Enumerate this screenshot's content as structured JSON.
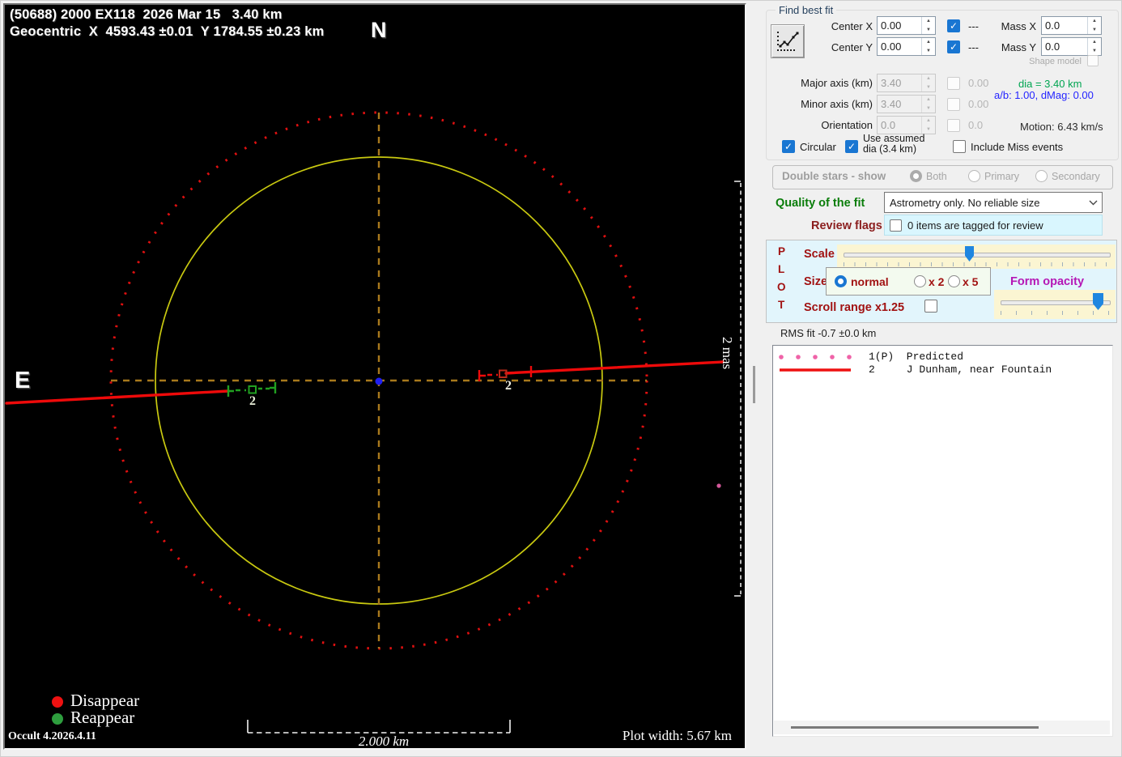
{
  "plot": {
    "title_line1": "(50688) 2000 EX118  2026 Mar 15   3.40 km",
    "title_line2": "Geocentric  X  4593.43 ±0.01  Y 1784.55 ±0.23 km",
    "north": "N",
    "east": "E",
    "legend": {
      "disappear": "Disappear",
      "reappear": "Reappear"
    },
    "version": "Occult 4.2026.4.11",
    "scale_bar_label": "2.000 km",
    "plot_width_label": "Plot width: 5.67 km",
    "mas_scale_label": "2 mas",
    "chord_point_labels": {
      "disappear": "2",
      "reappear": "2"
    },
    "colors": {
      "uncertainty_circle": "#e01010",
      "asteroid_circle": "#c9c910",
      "crosshair": "#a8791c",
      "chord": "#ee0a0a",
      "reappear_marks": "#21a021",
      "center_dot": "#2020f0"
    }
  },
  "panel": {
    "find_best_fit": {
      "title": "Find best fit",
      "center_x_label": "Center X",
      "center_x_value": "0.00",
      "center_x_fit": "---",
      "center_y_label": "Center Y",
      "center_y_value": "0.00",
      "center_y_fit": "---",
      "mass_x_label": "Mass X",
      "mass_x_value": "0.0",
      "mass_y_label": "Mass Y",
      "mass_y_value": "0.0",
      "shape_model_label": "Shape model",
      "major_axis_label": "Major axis (km)",
      "major_axis_value": "3.40",
      "major_axis_fit": "0.00",
      "minor_axis_label": "Minor axis (km)",
      "minor_axis_value": "3.40",
      "minor_axis_fit": "0.00",
      "orientation_label": "Orientation",
      "orientation_value": "0.0",
      "orientation_fit": "0.0",
      "dia_text": "dia = 3.40 km",
      "ab_text": "a/b: 1.00, dMag: 0.00",
      "motion_text": "Motion: 6.43 km/s",
      "circular_label": "Circular",
      "use_assumed_line1": "Use assumed",
      "use_assumed_line2": "dia (3.4 km)",
      "include_miss_label": "Include Miss events"
    },
    "double_stars": {
      "title": "Double stars - show",
      "option_both": "Both",
      "option_primary": "Primary",
      "option_secondary": "Secondary"
    },
    "quality_of_fit": {
      "label": "Quality of the fit",
      "value": "Astrometry only. No reliable size"
    },
    "review_flags": {
      "label": "Review flags",
      "value": "0 items are tagged for review"
    },
    "plot_controls": {
      "p": "P",
      "l": "L",
      "o": "O",
      "t": "T",
      "scale_label": "Scale",
      "size_label": "Size",
      "size_normal": "normal",
      "size_x2": "x 2",
      "size_x5": "x 5",
      "form_opacity_label": "Form opacity",
      "scroll_range_label": "Scroll range x1.25"
    },
    "rms_text": "RMS fit -0.7 ±0.0 km",
    "observations": [
      {
        "row": "1(P)  Predicted"
      },
      {
        "row": "2     J Dunham, near Fountain"
      }
    ]
  }
}
